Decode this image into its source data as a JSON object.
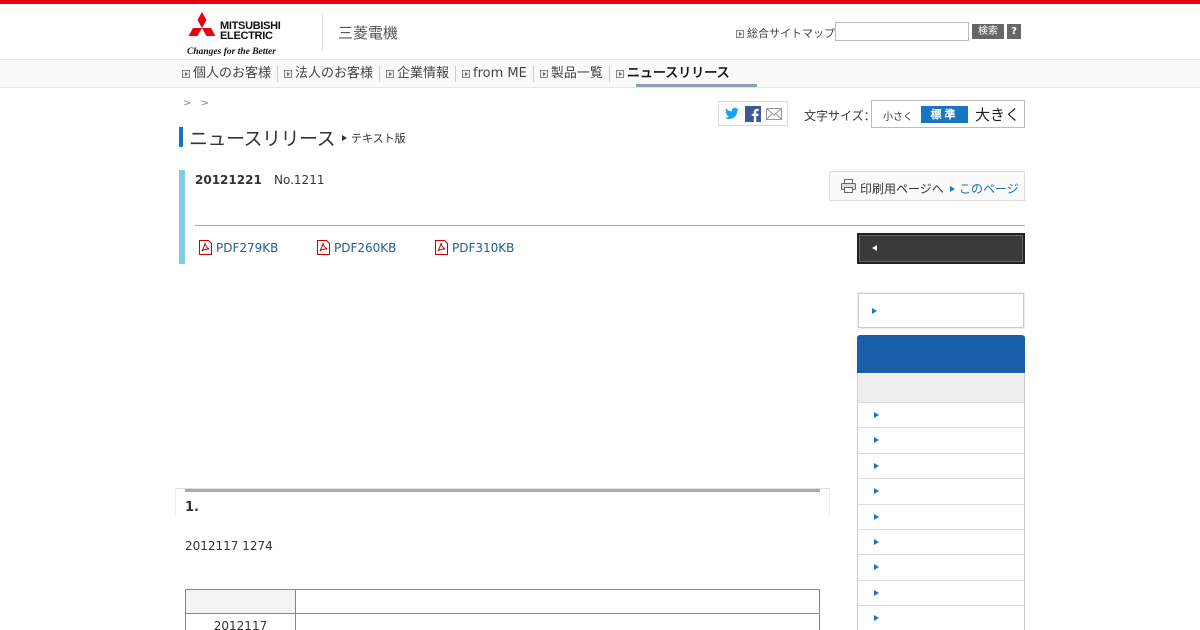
{
  "brand": {
    "logo_word_1": "MITSUBISHI",
    "logo_word_2": "ELECTRIC",
    "tagline": "Changes for the Better",
    "site_name": "三菱電機",
    "accent_red": "#e60012",
    "accent_blue": "#1a74c4"
  },
  "header": {
    "sitemap_label": "総合サイトマップ",
    "search_placeholder": "",
    "search_button": "検索",
    "help_button": "?"
  },
  "global_nav": {
    "items": [
      {
        "label": "個人のお客様",
        "active": false
      },
      {
        "label": "法人のお客様",
        "active": false
      },
      {
        "label": "企業情報",
        "active": false
      },
      {
        "label": "from ME",
        "active": false
      },
      {
        "label": "製品一覧",
        "active": false
      },
      {
        "label": "ニュースリリース",
        "active": true
      }
    ]
  },
  "breadcrumb": ">  >",
  "share": {
    "icons": [
      "twitter-icon",
      "facebook-icon",
      "mail-icon"
    ]
  },
  "font_size": {
    "label": "文字サイズ：",
    "small": "小さく",
    "standard": "標準",
    "large": "大きく",
    "selected": "標準"
  },
  "page": {
    "title": "ニュースリリース",
    "text_version_link": "テキスト版"
  },
  "release": {
    "date": "20121221",
    "number": "No.1211",
    "print_label": "印刷用ページへ",
    "this_page_label": "このページ",
    "pdfs": [
      "PDF279KB",
      "PDF260KB",
      "PDF310KB"
    ]
  },
  "sidebar": {
    "dark_button_label": "",
    "light_button_label": "",
    "header_label": "",
    "sub_label": "",
    "item_count_visible": 9
  },
  "section": {
    "number": "1.",
    "text": "2012117 1274",
    "table": {
      "rows": [
        [
          "",
          ""
        ],
        [
          "2012117",
          ""
        ]
      ]
    }
  }
}
